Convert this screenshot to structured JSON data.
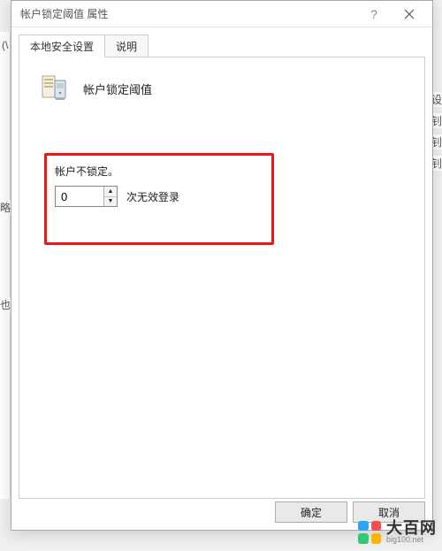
{
  "dialog": {
    "title": "帐户锁定阈值 属性"
  },
  "tabs": {
    "local_security": "本地安全设置",
    "description": "说明"
  },
  "policy": {
    "heading": "帐户锁定阈值",
    "not_locked_label": "帐户不锁定。",
    "value": "0",
    "suffix": "次无效登录"
  },
  "buttons": {
    "ok": "确定",
    "cancel": "取消"
  },
  "watermark": {
    "brand": "大百网",
    "url": "big100.net"
  },
  "bg_fragments": {
    "a": "设",
    "b": "钊",
    "c": "钊",
    "d": "钊",
    "e": "略",
    "f": "也"
  }
}
